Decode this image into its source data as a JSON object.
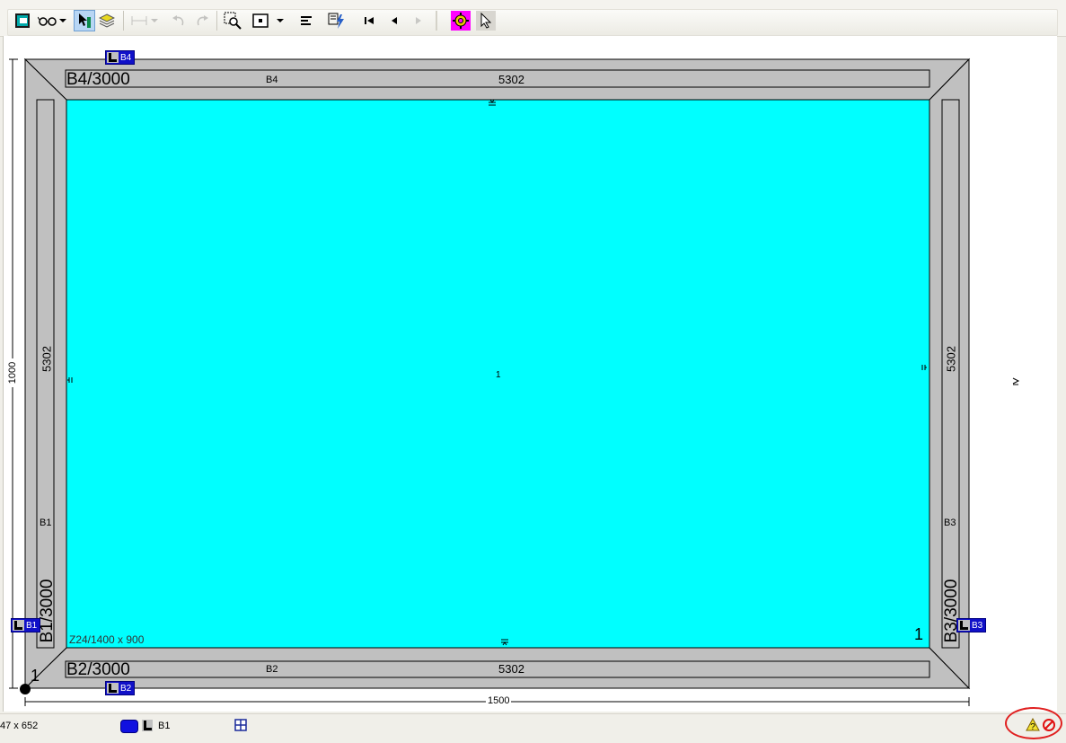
{
  "toolbar": {
    "buttons": [
      {
        "name": "view-frame-button",
        "icon": "frame-icon",
        "state": "normal"
      },
      {
        "name": "glasses-button",
        "icon": "glasses-icon",
        "state": "normal",
        "dropdown": true
      },
      {
        "name": "select-tool-button",
        "icon": "pointer-figure-icon",
        "state": "active"
      },
      {
        "name": "layers-button",
        "icon": "layers-icon",
        "state": "normal"
      },
      {
        "name": "dimension-button",
        "icon": "dimension-icon",
        "state": "disabled",
        "dropdown": true
      },
      {
        "name": "undo-button",
        "icon": "undo-icon",
        "state": "disabled"
      },
      {
        "name": "redo-button",
        "icon": "redo-icon",
        "state": "disabled"
      },
      {
        "name": "zoom-select-button",
        "icon": "zoom-select-icon",
        "state": "normal"
      },
      {
        "name": "zoom-window-button",
        "icon": "zoom-window-icon",
        "state": "normal",
        "dropdown": true
      },
      {
        "name": "align-left-button",
        "icon": "align-left-icon",
        "state": "normal"
      },
      {
        "name": "lightning-button",
        "icon": "lightning-icon",
        "state": "normal"
      },
      {
        "name": "first-button",
        "icon": "first-icon",
        "state": "normal"
      },
      {
        "name": "previous-button",
        "icon": "previous-icon",
        "state": "normal"
      },
      {
        "name": "next-button",
        "icon": "next-icon",
        "state": "disabled"
      },
      {
        "name": "settings-gear-button",
        "icon": "gear-icon",
        "state": "normal"
      },
      {
        "name": "cursor-button",
        "icon": "cursor-icon",
        "state": "normal"
      }
    ]
  },
  "drawing": {
    "colors": {
      "glass": "#00ffff",
      "profile": "#c0c0c0",
      "tag": "#1010c8"
    },
    "top_profile": {
      "label": "B4/3000",
      "code": "B4",
      "length": "5302"
    },
    "bottom_profile": {
      "label": "B2/3000",
      "code": "B2",
      "length": "5302"
    },
    "left_profile": {
      "label": "B1/3000",
      "code": "B1",
      "length": "5302"
    },
    "right_profile": {
      "label": "B3/3000",
      "code": "B3",
      "length": "5302"
    },
    "tags": {
      "top": "B4",
      "bottom": "B2",
      "left": "B1",
      "right": "B3"
    },
    "glass_label": "Z24/1400 x 900",
    "center_number": "1",
    "glass_number": "1",
    "corner_number": "1",
    "width_dimension": "1500",
    "height_dimension": "1000"
  },
  "status": {
    "coordinates": "47 x 652",
    "current_profile": "B1"
  }
}
